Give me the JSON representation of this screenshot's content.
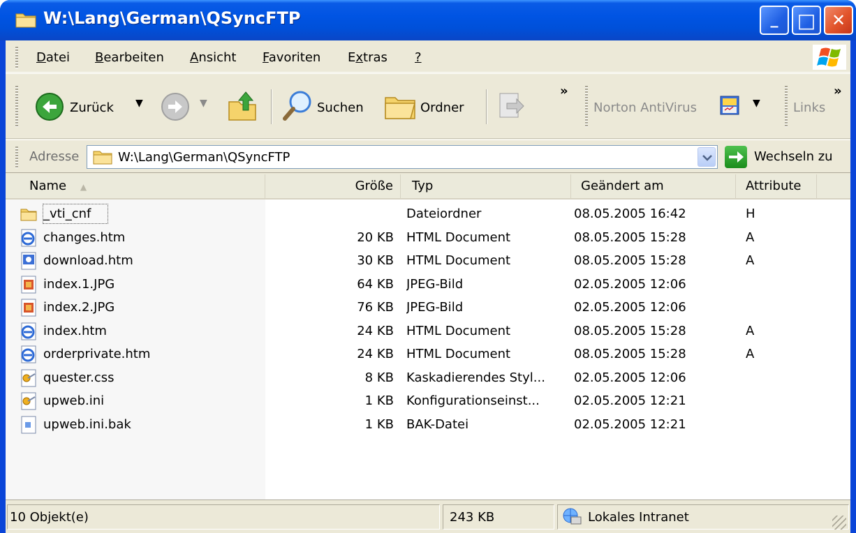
{
  "window": {
    "title": "W:\\Lang\\German\\QSyncFTP",
    "min_glyph": "_",
    "max_glyph": "□",
    "close_glyph": "✕"
  },
  "menu": {
    "items": [
      {
        "pre": "",
        "u": "D",
        "post": "atei"
      },
      {
        "pre": "",
        "u": "B",
        "post": "earbeiten"
      },
      {
        "pre": "",
        "u": "A",
        "post": "nsicht"
      },
      {
        "pre": "",
        "u": "F",
        "post": "avoriten"
      },
      {
        "pre": "E",
        "u": "x",
        "post": "tras"
      },
      {
        "pre": "",
        "u": "?",
        "post": ""
      }
    ]
  },
  "toolbar": {
    "back_label": "Zurück",
    "search_label": "Suchen",
    "folders_label": "Ordner",
    "chevron1": "»",
    "norton_label": "Norton AntiVirus",
    "links_label": "Links",
    "chevron2": "»"
  },
  "address": {
    "label": "Adresse",
    "value": "W:\\Lang\\German\\QSyncFTP",
    "go_label": "Wechseln zu"
  },
  "columns": {
    "name": "Name",
    "size": "Größe",
    "type": "Typ",
    "modified": "Geändert am",
    "attributes": "Attribute"
  },
  "files": [
    {
      "name": "_vti_cnf",
      "size": "",
      "type": "Dateiordner",
      "modified": "08.05.2005 16:42",
      "attr": "H",
      "icon": "folder-icon"
    },
    {
      "name": "changes.htm",
      "size": "20 KB",
      "type": "HTML Document",
      "modified": "08.05.2005 15:28",
      "attr": "A",
      "icon": "ie-html-icon"
    },
    {
      "name": "download.htm",
      "size": "30 KB",
      "type": "HTML Document",
      "modified": "08.05.2005 15:28",
      "attr": "A",
      "icon": "html-frontpage-icon"
    },
    {
      "name": "index.1.JPG",
      "size": "64 KB",
      "type": "JPEG-Bild",
      "modified": "02.05.2005 12:06",
      "attr": "",
      "icon": "jpeg-icon"
    },
    {
      "name": "index.2.JPG",
      "size": "76 KB",
      "type": "JPEG-Bild",
      "modified": "02.05.2005 12:06",
      "attr": "",
      "icon": "jpeg-icon"
    },
    {
      "name": "index.htm",
      "size": "24 KB",
      "type": "HTML Document",
      "modified": "08.05.2005 15:28",
      "attr": "A",
      "icon": "ie-html-icon"
    },
    {
      "name": "orderprivate.htm",
      "size": "24 KB",
      "type": "HTML Document",
      "modified": "08.05.2005 15:28",
      "attr": "A",
      "icon": "ie-html-icon"
    },
    {
      "name": "quester.css",
      "size": "8 KB",
      "type": "Kaskadierendes Styl...",
      "modified": "02.05.2005 12:06",
      "attr": "",
      "icon": "settings-file-icon"
    },
    {
      "name": "upweb.ini",
      "size": "1 KB",
      "type": "Konfigurationseinst...",
      "modified": "02.05.2005 12:21",
      "attr": "",
      "icon": "settings-file-icon"
    },
    {
      "name": "upweb.ini.bak",
      "size": "1 KB",
      "type": "BAK-Datei",
      "modified": "02.05.2005 12:21",
      "attr": "",
      "icon": "generic-file-icon"
    }
  ],
  "status": {
    "objects": "10 Objekt(e)",
    "size": "243 KB",
    "zone": "Lokales Intranet"
  },
  "colors": {
    "titlebar": "#0054e3",
    "chrome": "#ece9d8",
    "sorted_column": "#f7f7f7"
  }
}
